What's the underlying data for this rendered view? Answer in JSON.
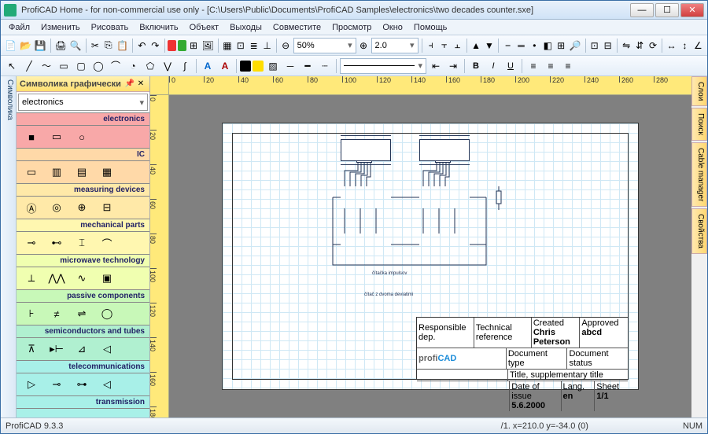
{
  "window": {
    "title": "ProfiCAD Home - for non-commercial use only - [C:\\Users\\Public\\Documents\\ProfiCAD Samples\\electronics\\two decades counter.sxe]",
    "min": "—",
    "max": "☐",
    "close": "✕"
  },
  "menu": [
    "Файл",
    "Изменить",
    "Рисовать",
    "Включить",
    "Объект",
    "Выходы",
    "Совместите",
    "Просмотр",
    "Окно",
    "Помощь"
  ],
  "toolbar1": {
    "zoom": "50%",
    "scale": "2.0"
  },
  "leftTab": "Символика",
  "panel": {
    "title": "Символика графически",
    "category": "electronics"
  },
  "categories": [
    {
      "name": "electronics",
      "cls": "c0",
      "items": [
        "■",
        "▭",
        "○"
      ]
    },
    {
      "name": "IC",
      "cls": "c1",
      "items": [
        "▭",
        "▥",
        "▤",
        "▦"
      ]
    },
    {
      "name": "measuring devices",
      "cls": "c2",
      "items": [
        "Ⓐ",
        "◎",
        "⊕",
        "⊟"
      ]
    },
    {
      "name": "mechanical parts",
      "cls": "c3",
      "items": [
        "⊸",
        "⊷",
        "⌶",
        "⌒"
      ]
    },
    {
      "name": "microwave technology",
      "cls": "c4",
      "items": [
        "⟂",
        "⋀⋀",
        "∿",
        "▣"
      ]
    },
    {
      "name": "passive components",
      "cls": "c5",
      "items": [
        "⊦",
        "≠",
        "⇌",
        "◯"
      ]
    },
    {
      "name": "semiconductors and tubes",
      "cls": "c6",
      "items": [
        "⊼",
        "▸⊢",
        "⊿",
        "◁"
      ]
    },
    {
      "name": "telecommunications",
      "cls": "c7",
      "items": [
        "▷",
        "⊸",
        "⊶",
        "◁"
      ]
    },
    {
      "name": "transmission",
      "cls": "c7",
      "items": []
    }
  ],
  "ruler": {
    "hticks": [
      0,
      20,
      40,
      60,
      80,
      100,
      120,
      140,
      160,
      180,
      200,
      220,
      240,
      260,
      280
    ]
  },
  "drawing": {
    "note1": "čítačka impulsov",
    "note2": "čítač z dvoma deviatimi",
    "titleblock": {
      "r1": [
        "Responsible dep.",
        "Technical reference",
        "Created",
        "",
        "Approved"
      ],
      "r1b": [
        "",
        "",
        "Chris Peterson",
        "",
        "abcd"
      ],
      "r2": [
        "Document type",
        "",
        "",
        "Document status",
        ""
      ],
      "r3": [
        "Title, supplementary title",
        "",
        "",
        "",
        ""
      ],
      "r4": [
        "",
        "Date of issue",
        "Lang.",
        "Sheet"
      ],
      "r4b": [
        "",
        "5.6.2000",
        "en",
        "1/1"
      ]
    }
  },
  "rightTabs": [
    "Слои",
    "Поиск",
    "Cable manager",
    "Свойства"
  ],
  "status": {
    "version": "ProfiCAD 9.3.3",
    "coords": "/1.  x=210.0  y=-34.0 (0)",
    "num": "NUM"
  }
}
